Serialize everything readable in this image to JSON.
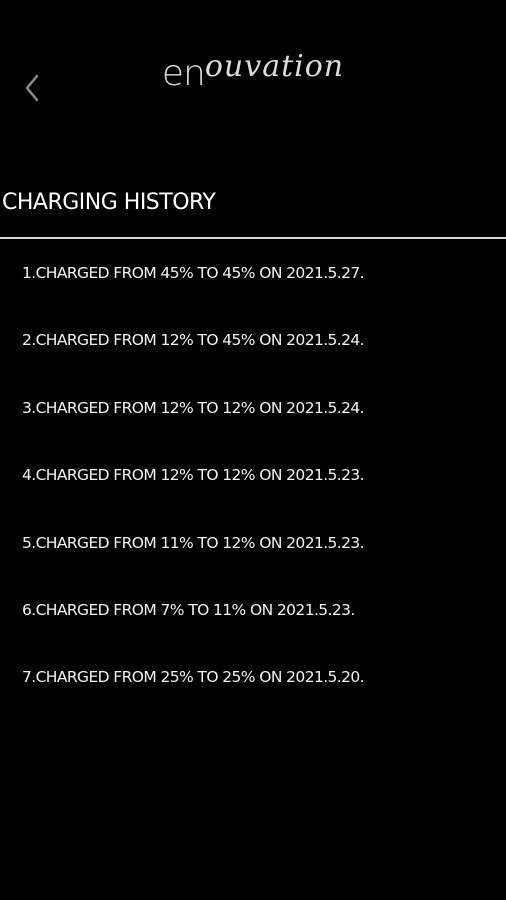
{
  "header": {
    "logo": {
      "prefix": "en",
      "suffix": "ouvation"
    },
    "back_icon": "chevron-left-icon"
  },
  "section": {
    "title": "CHARGING HISTORY"
  },
  "history": [
    "1.CHARGED FROM 45% TO 45% ON 2021.5.27.",
    "2.CHARGED FROM 12% TO 45% ON 2021.5.24.",
    "3.CHARGED FROM 12% TO 12% ON 2021.5.24.",
    "4.CHARGED FROM 12% TO 12% ON 2021.5.23.",
    "5.CHARGED FROM 11% TO 12% ON 2021.5.23.",
    "6.CHARGED FROM 7% TO 11% ON 2021.5.23.",
    "7.CHARGED FROM 25% TO 25% ON 2021.5.20."
  ],
  "colors": {
    "background": "#000000",
    "text": "#ffffff",
    "divider": "#d9d9d9",
    "icon": "#8c8c8c"
  }
}
